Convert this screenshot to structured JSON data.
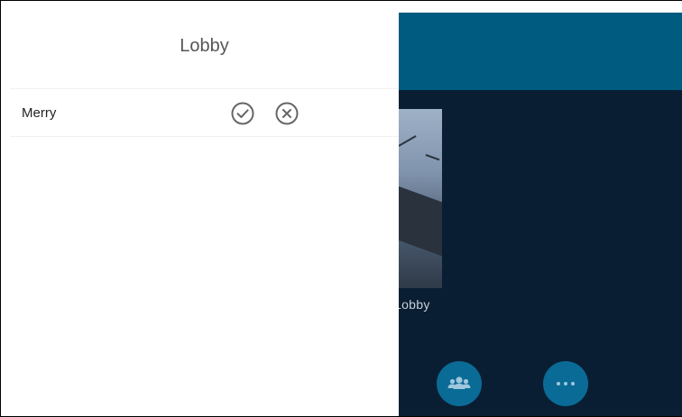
{
  "lobby": {
    "title": "Lobby",
    "participants": [
      {
        "name": "Merry",
        "accept_icon": "check-circle-icon",
        "reject_icon": "x-circle-icon"
      }
    ]
  },
  "background": {
    "tile_caption": "Lobby",
    "controls": [
      {
        "icon": "people-icon"
      },
      {
        "icon": "more-icon"
      }
    ]
  },
  "colors": {
    "header": "#005b80",
    "background": "#0a1e33",
    "button": "#0a6b96",
    "icon_gray": "#666666"
  }
}
